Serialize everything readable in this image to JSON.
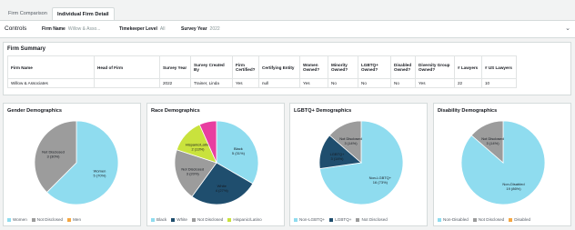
{
  "tabs": [
    {
      "label": "Firm Comparison",
      "active": false
    },
    {
      "label": "Individual Firm Detail",
      "active": true
    }
  ],
  "controls": {
    "title": "Controls",
    "firm_name": {
      "label": "Firm Name",
      "value": "Willow & Asso..."
    },
    "timekeeper": {
      "label": "Timekeeper Level",
      "value": "All"
    },
    "survey_year": {
      "label": "Survey Year",
      "value": "2022"
    }
  },
  "summary": {
    "title": "Firm Summary",
    "headers": [
      "Firm Name",
      "Head of Firm",
      "Survey Year",
      "Survey Created By",
      "Firm Certified?",
      "Certifying Entity",
      "Women Owned?",
      "Minority Owned?",
      "LGBTQ+ Owned?",
      "Disabled Owned?",
      "Diversity Group Owned?",
      "# Lawyers",
      "# US Lawyers"
    ],
    "row": [
      "Willow & Associates",
      "",
      "2022",
      "Trainer, Linda",
      "Yes",
      "null",
      "Yes",
      "No",
      "No",
      "No",
      "Yes",
      "22",
      "10"
    ]
  },
  "charts": [
    {
      "title": "Gender Demographics",
      "colors": [
        "#8fdcef",
        "#9c9c9c",
        "#f5a742"
      ],
      "legend": [
        "Women",
        "Not Disclosed",
        "Men"
      ],
      "slice_labels": [
        "Women\n5 (70%)",
        "Not Disclosed\n3 (30%)",
        ""
      ]
    },
    {
      "title": "Race Demographics",
      "colors": [
        "#8fdcef",
        "#1f4e6e",
        "#9c9c9c",
        "#c9e23d",
        "#e83ea0"
      ],
      "legend": [
        "Black",
        "White",
        "Not Disclosed",
        "Hispanic/Latino"
      ],
      "slice_labels": [
        "Black\n5 (31%)",
        "White\n4 (27%)",
        "Not Disclosed\n3 (20%)",
        "Hispanic/Latino\n2 (13%)",
        ""
      ]
    },
    {
      "title": "LGBTQ+ Demographics",
      "colors": [
        "#8fdcef",
        "#1f4e6e",
        "#9c9c9c"
      ],
      "legend": [
        "Non-LGBTQ+",
        "LGBTQ+",
        "Not Disclosed"
      ],
      "slice_labels": [
        "Non-LGBTQ+\n16 (73%)",
        "LGBTQ+\n3 (14%)",
        "Not Disclosed\n3 (14%)"
      ]
    },
    {
      "title": "Disability Demographics",
      "colors": [
        "#8fdcef",
        "#9c9c9c",
        "#f5a742"
      ],
      "legend": [
        "Non-Disabled",
        "Not Disclosed",
        "Disabled"
      ],
      "slice_labels": [
        "Non-Disabled\n19 (86%)",
        "Not Disclosed\n3 (14%)",
        ""
      ]
    }
  ],
  "chart_data": [
    {
      "type": "pie",
      "title": "Gender Demographics",
      "categories": [
        "Women",
        "Not Disclosed",
        "Men"
      ],
      "values": [
        5,
        3,
        0
      ],
      "percent": [
        70,
        30,
        0
      ]
    },
    {
      "type": "pie",
      "title": "Race Demographics",
      "categories": [
        "Black",
        "White",
        "Not Disclosed",
        "Hispanic/Latino",
        "Other"
      ],
      "values": [
        5,
        4,
        3,
        2,
        1
      ],
      "percent": [
        31,
        27,
        20,
        13,
        9
      ]
    },
    {
      "type": "pie",
      "title": "LGBTQ+ Demographics",
      "categories": [
        "Non-LGBTQ+",
        "LGBTQ+",
        "Not Disclosed"
      ],
      "values": [
        16,
        3,
        3
      ],
      "percent": [
        73,
        14,
        14
      ]
    },
    {
      "type": "pie",
      "title": "Disability Demographics",
      "categories": [
        "Non-Disabled",
        "Not Disclosed",
        "Disabled"
      ],
      "values": [
        19,
        3,
        0
      ],
      "percent": [
        86,
        14,
        0
      ]
    }
  ]
}
